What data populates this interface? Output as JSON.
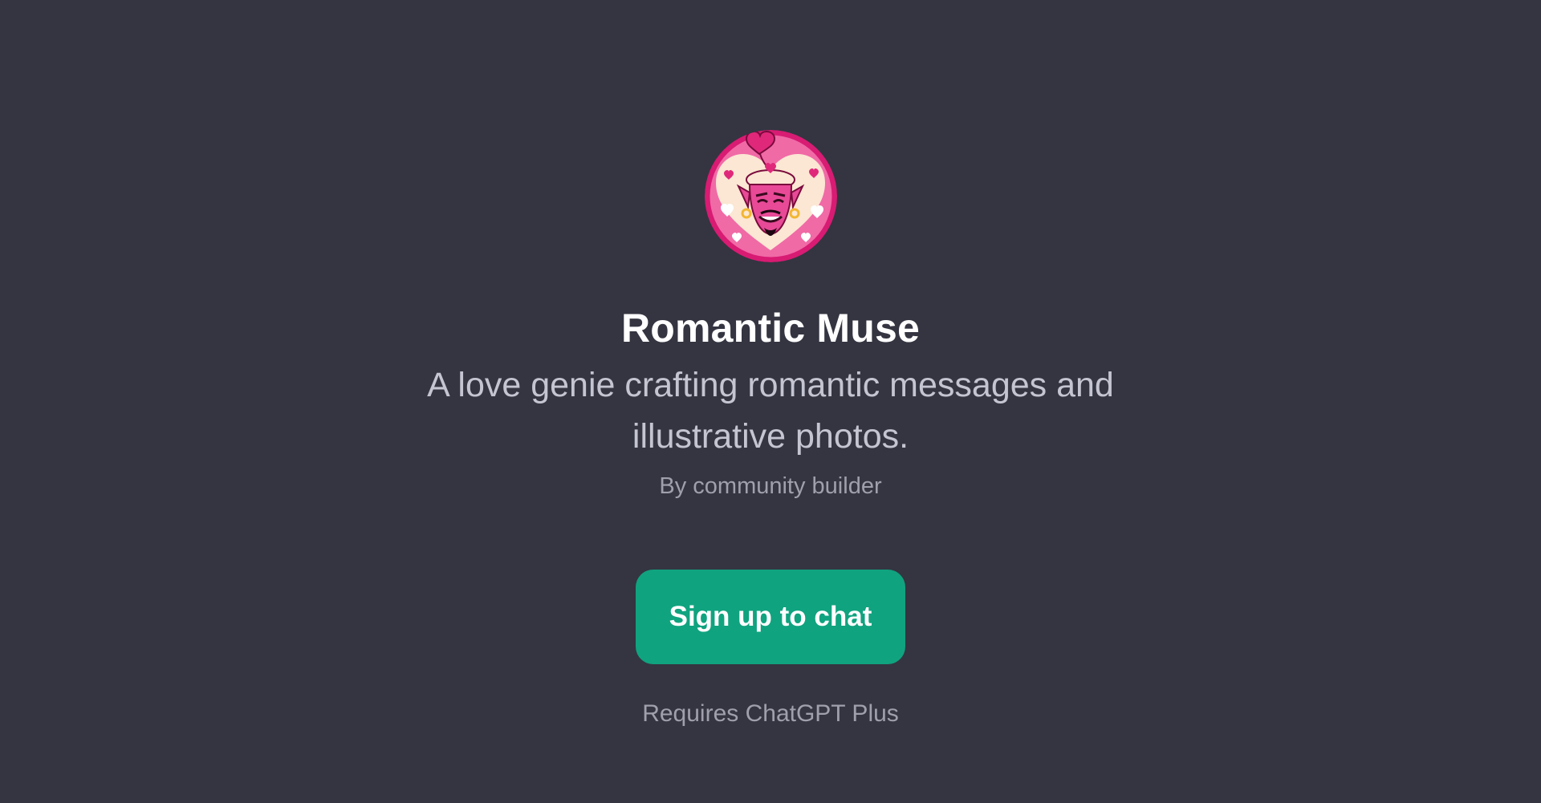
{
  "gpt": {
    "avatar_icon": "love-genie-avatar",
    "name": "Romantic Muse",
    "description": "A love genie crafting romantic messages and illustrative photos.",
    "byline": "By community builder"
  },
  "actions": {
    "signup_label": "Sign up to chat",
    "requirement_note": "Requires ChatGPT Plus"
  },
  "colors": {
    "background": "#343541",
    "accent": "#10a37f",
    "avatar_primary": "#e0287a"
  }
}
